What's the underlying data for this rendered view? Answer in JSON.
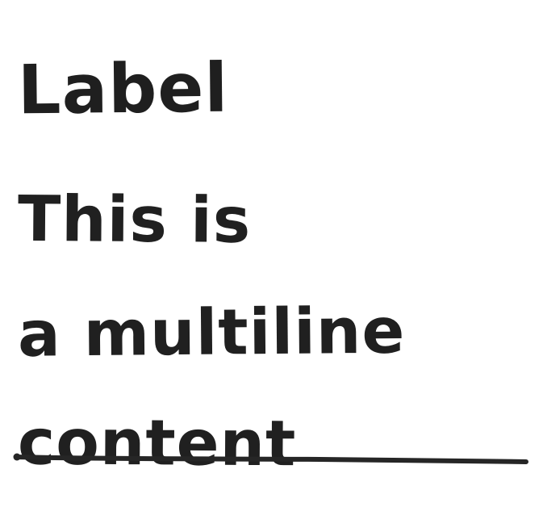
{
  "field": {
    "label": "Label",
    "content_lines": [
      "This is",
      "a multiline",
      "content"
    ]
  },
  "colors": {
    "ink": "#202020",
    "background": "#ffffff"
  }
}
